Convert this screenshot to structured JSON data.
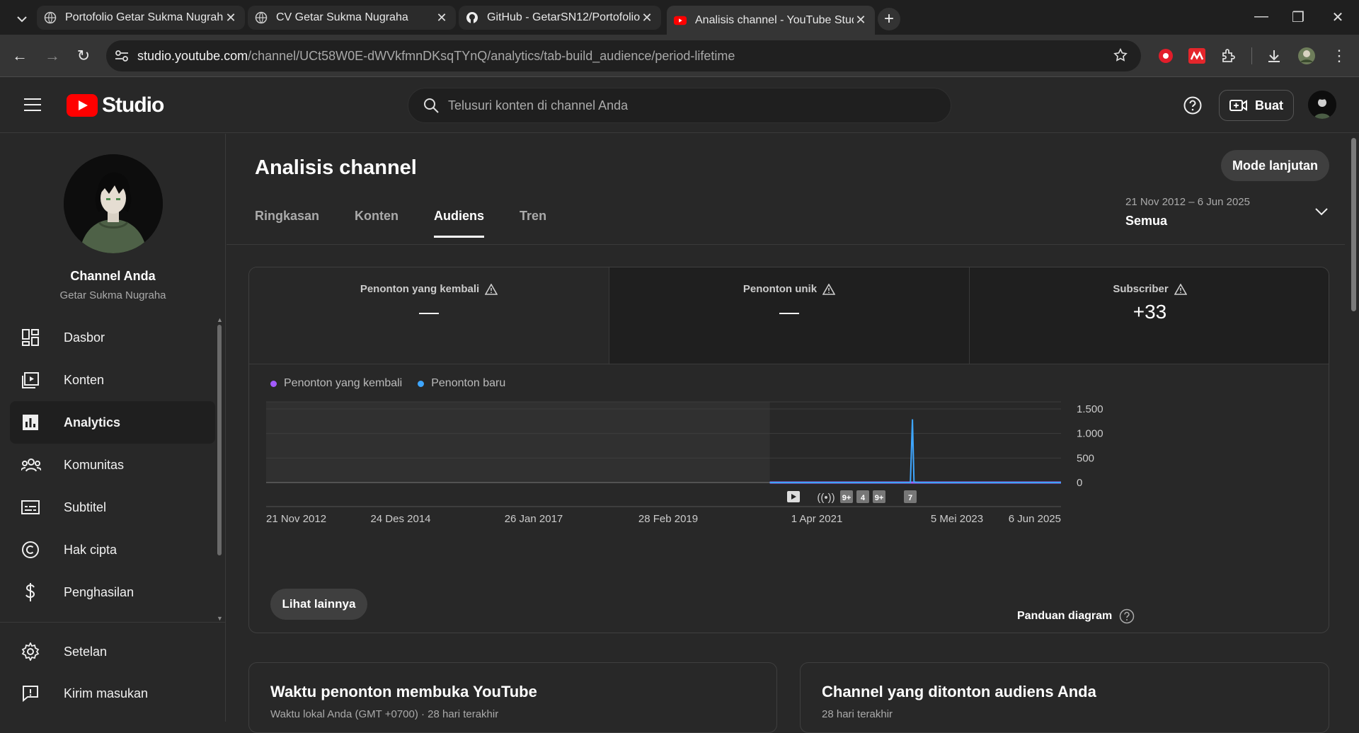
{
  "browser": {
    "tabs": [
      {
        "title": "Portofolio Getar Sukma Nugraha",
        "close": "✕"
      },
      {
        "title": "CV Getar Sukma Nugraha",
        "close": "✕"
      },
      {
        "title": "GitHub - GetarSN12/Portofolio",
        "close": "✕"
      },
      {
        "title": "Analisis channel - YouTube Studio",
        "close": "✕"
      }
    ],
    "url_host": "studio.youtube.com",
    "url_path": "/channel/UCt58W0E-dWVkfmnDKsqTYnQ/analytics/tab-build_audience/period-lifetime"
  },
  "header": {
    "logo_text": "Studio",
    "search_placeholder": "Telusuri konten di channel Anda",
    "create_label": "Buat"
  },
  "sidebar": {
    "channel_title": "Channel Anda",
    "channel_name": "Getar Sukma Nugraha",
    "items": [
      {
        "label": "Dasbor",
        "icon": "dashboard-icon"
      },
      {
        "label": "Konten",
        "icon": "content-icon"
      },
      {
        "label": "Analytics",
        "icon": "analytics-icon",
        "active": true
      },
      {
        "label": "Komunitas",
        "icon": "community-icon"
      },
      {
        "label": "Subtitel",
        "icon": "subtitles-icon"
      },
      {
        "label": "Hak cipta",
        "icon": "copyright-icon"
      },
      {
        "label": "Penghasilan",
        "icon": "dollar-icon"
      }
    ],
    "bottom_items": [
      {
        "label": "Setelan",
        "icon": "gear-icon"
      },
      {
        "label": "Kirim masukan",
        "icon": "feedback-icon"
      }
    ]
  },
  "main": {
    "title": "Analisis channel",
    "advanced_mode": "Mode lanjutan",
    "tabs": [
      "Ringkasan",
      "Konten",
      "Audiens",
      "Tren"
    ],
    "active_tab": "Audiens",
    "date_range": "21 Nov 2012 – 6 Jun 2025",
    "date_label": "Semua",
    "metrics": [
      {
        "label": "Penonton yang kembali",
        "value": "—"
      },
      {
        "label": "Penonton unik",
        "value": "—"
      },
      {
        "label": "Subscriber",
        "value": "+33"
      }
    ],
    "see_more": "Lihat lainnya",
    "chart_guide": "Panduan diagram",
    "markers": [
      "9+",
      "4",
      "9+",
      "7"
    ],
    "card_left": {
      "title": "Waktu penonton membuka YouTube",
      "subtitle": "Waktu lokal Anda (GMT +0700) · 28 hari terakhir"
    },
    "card_right": {
      "title": "Channel yang ditonton audiens Anda",
      "subtitle": "28 hari terakhir"
    }
  },
  "colors": {
    "returning": "#a35bff",
    "new": "#3ea6ff",
    "brand_red": "#ff0000"
  },
  "chart_data": {
    "type": "line",
    "x_ticks": [
      "21 Nov 2012",
      "24 Des 2014",
      "26 Jan 2017",
      "28 Feb 2019",
      "1 Apr 2021",
      "5 Mei 2023",
      "6 Jun 2025"
    ],
    "y_ticks": [
      "1.500",
      "1.000",
      "500",
      "0"
    ],
    "ylim": [
      0,
      1500
    ],
    "series": [
      {
        "name": "Penonton yang kembali",
        "color": "#a35bff",
        "points": [
          [
            "2020-11-01",
            0
          ],
          [
            "2025-06-06",
            0
          ]
        ]
      },
      {
        "name": "Penonton baru",
        "color": "#3ea6ff",
        "points": [
          [
            "2020-11-01",
            0
          ],
          [
            "2023-01-20",
            0
          ],
          [
            "2023-02-01",
            1290
          ],
          [
            "2023-02-10",
            10
          ],
          [
            "2023-03-20",
            0
          ],
          [
            "2025-06-06",
            0
          ]
        ]
      }
    ],
    "no_data_before": "2020-11-01"
  }
}
